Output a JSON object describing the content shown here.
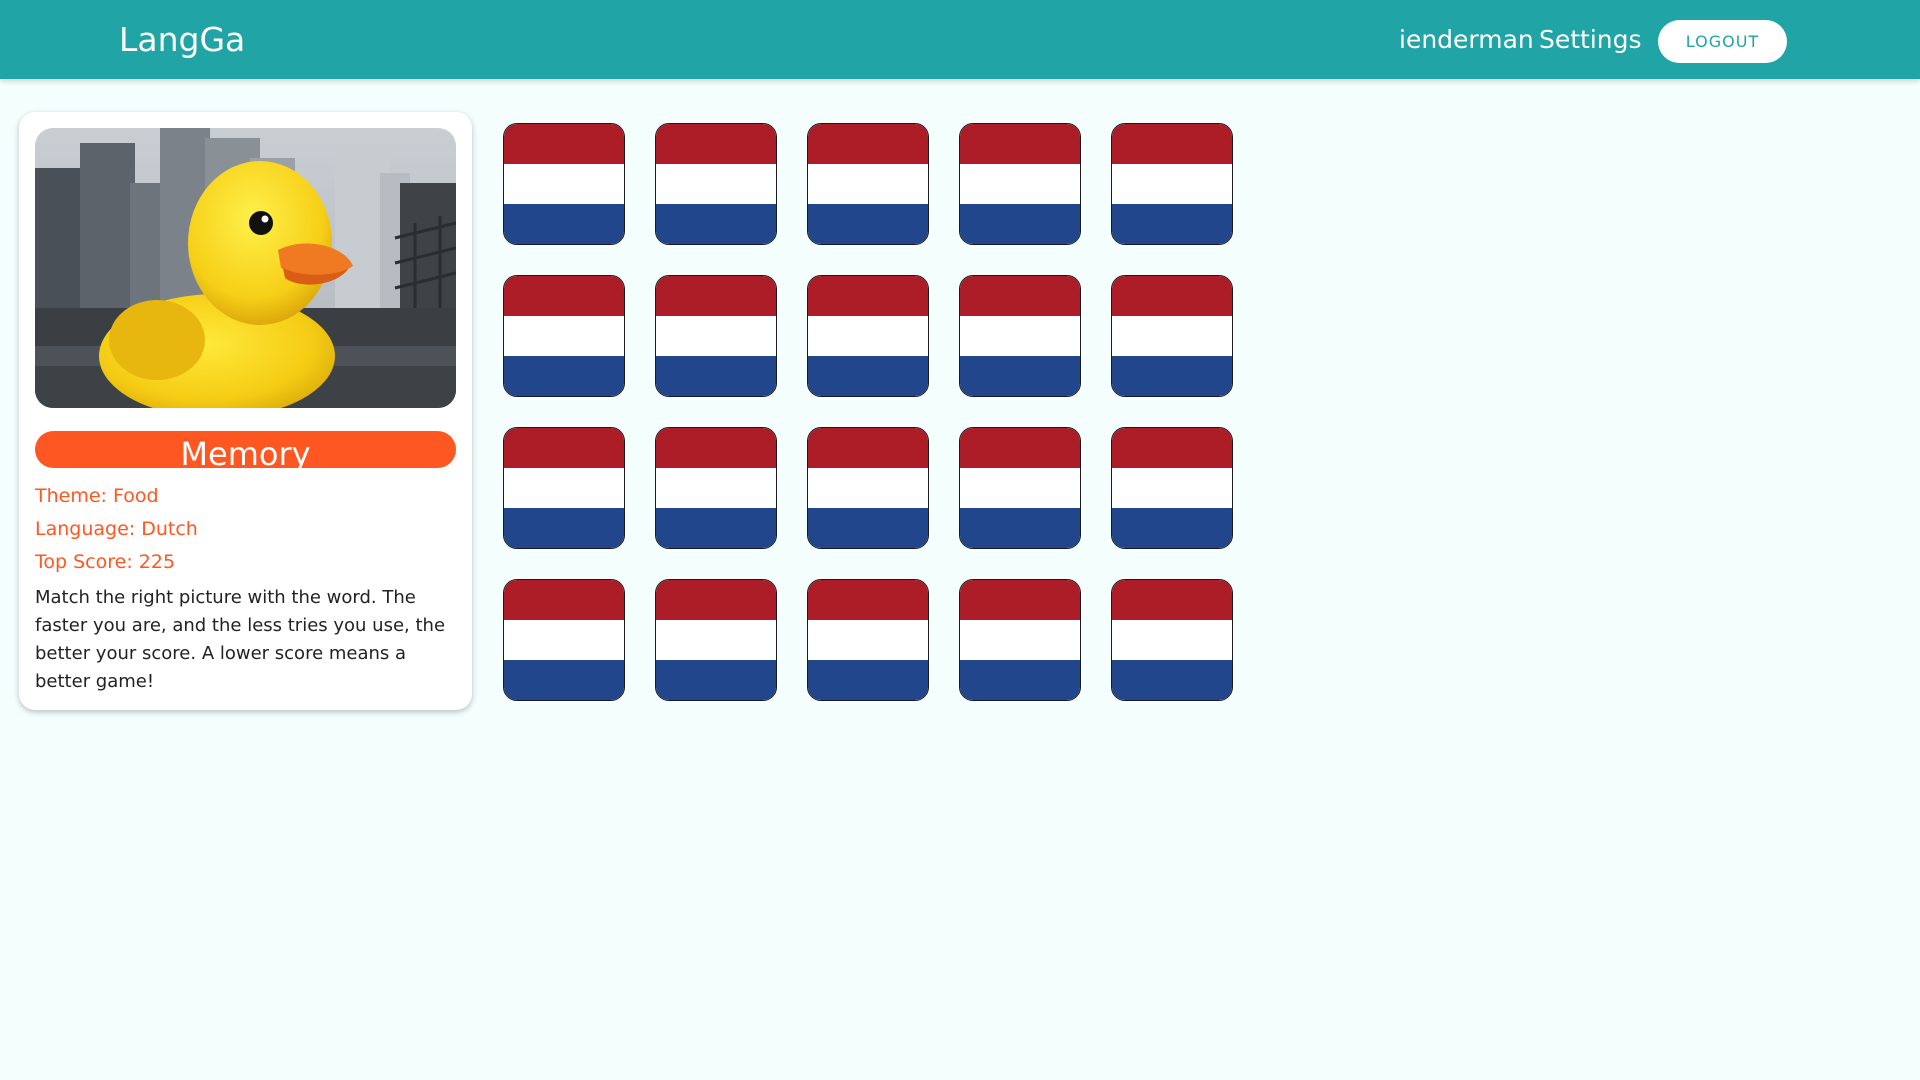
{
  "navbar": {
    "brand": "LangGa",
    "user": "ienderman",
    "settings": "Settings",
    "logout": "LOGOUT"
  },
  "game": {
    "image_subject": "giant yellow rubber duck in harbor",
    "title": "Memory",
    "theme_label": "Theme:",
    "theme": "Food",
    "language_label": "Language:",
    "language": "Dutch",
    "top_score_label": "Top Score:",
    "top_score": "225",
    "description": "Match the right picture with the word. The faster you are, and the less tries you use, the better your score. A lower score means a better game!"
  },
  "board": {
    "rows": 4,
    "columns": 5,
    "card_back": "dutch-flag-icon",
    "flag_colors": [
      "#AD1D28",
      "#FFFFFF",
      "#21468B"
    ]
  },
  "colors": {
    "navbar": "#20A4A6",
    "accent": "#FF5722",
    "background": "#F3FEFD"
  }
}
